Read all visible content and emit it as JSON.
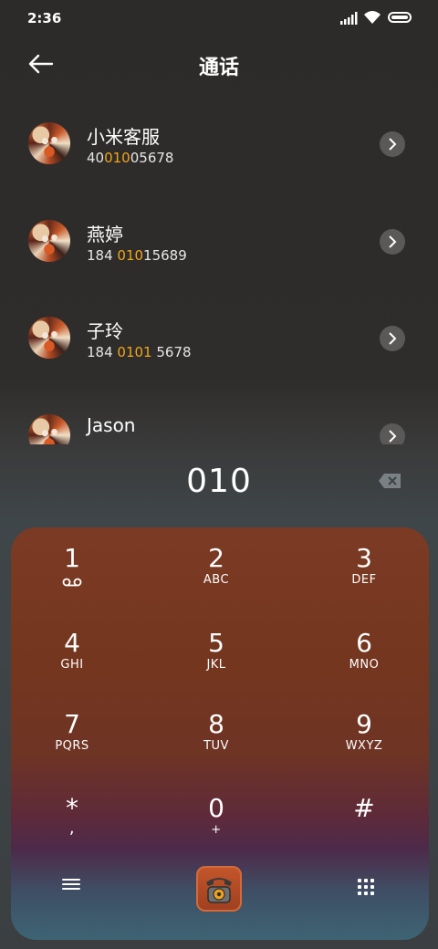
{
  "status_bar": {
    "time": "2:36"
  },
  "header": {
    "title": "通话"
  },
  "contacts": [
    {
      "name": "小米客服",
      "number_parts": [
        "40",
        "010",
        "05678"
      ]
    },
    {
      "name": "燕婷",
      "number_parts": [
        "184 ",
        "010",
        "15689"
      ]
    },
    {
      "name": "子玲",
      "number_parts": [
        "184 ",
        "0101",
        " 5678"
      ]
    },
    {
      "name": "Jason",
      "number_parts": [
        "",
        "",
        ""
      ]
    }
  ],
  "dialer": {
    "input": "010",
    "keys": [
      {
        "digit": "1",
        "letters": ""
      },
      {
        "digit": "2",
        "letters": "ABC"
      },
      {
        "digit": "3",
        "letters": "DEF"
      },
      {
        "digit": "4",
        "letters": "GHI"
      },
      {
        "digit": "5",
        "letters": "JKL"
      },
      {
        "digit": "6",
        "letters": "MNO"
      },
      {
        "digit": "7",
        "letters": "PQRS"
      },
      {
        "digit": "8",
        "letters": "TUV"
      },
      {
        "digit": "9",
        "letters": "WXYZ"
      },
      {
        "digit": "*",
        "letters": ","
      },
      {
        "digit": "0",
        "letters": "+"
      },
      {
        "digit": "#",
        "letters": ""
      }
    ]
  },
  "icons": {
    "back": "arrow-left-icon",
    "delete": "backspace-icon",
    "voicemail": "voicemail-icon",
    "menu": "menu-icon",
    "call": "rotary-phone-icon",
    "keypad": "keypad-grid-icon"
  },
  "colors": {
    "highlight": "#f2a51a"
  }
}
